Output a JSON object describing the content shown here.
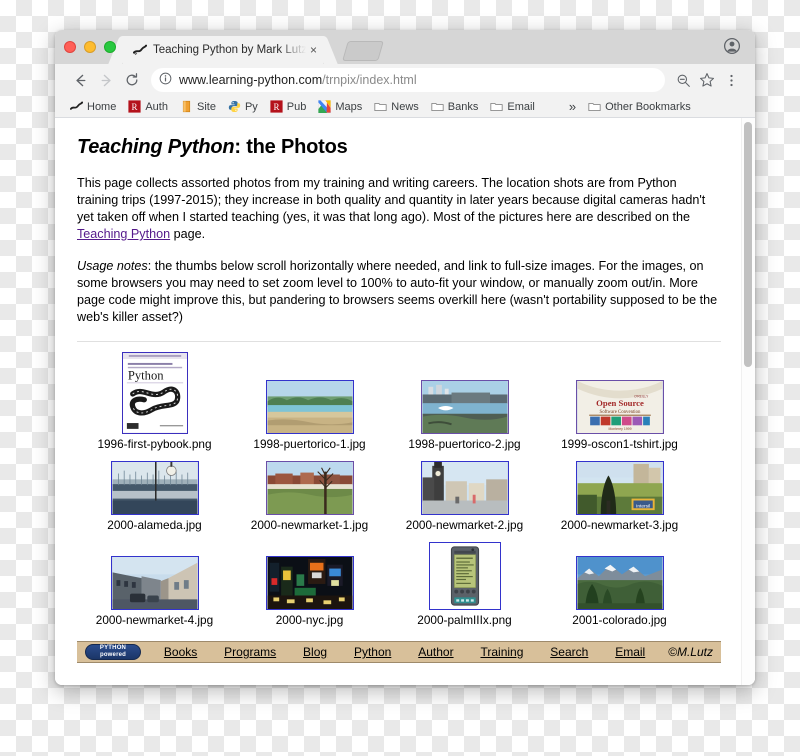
{
  "window": {
    "traffic_lights": [
      "close",
      "minimize",
      "maximize"
    ],
    "tab": {
      "title": "Teaching Python by Mark Lutz",
      "close_label": "×",
      "favicon": "python-snake-icon"
    },
    "new_tab_label": "+"
  },
  "toolbar": {
    "back_label": "←",
    "forward_label": "→",
    "reload_label": "↻",
    "url_host": "www.learning-python.com",
    "url_path": "/trnpix/index.html",
    "zoom_out_icon": "zoom-out-icon",
    "star_icon": "star-icon",
    "menu_icon": "three-dot-menu-icon",
    "profile_icon": "profile-avatar-icon"
  },
  "bookmarks": {
    "items": [
      {
        "label": "Home",
        "icon": "python-snake-icon"
      },
      {
        "label": "Auth",
        "icon": "oreilly-red-icon"
      },
      {
        "label": "Site",
        "icon": "orange-book-icon"
      },
      {
        "label": "Py",
        "icon": "python-logo-icon"
      },
      {
        "label": "Pub",
        "icon": "oreilly-red-icon"
      },
      {
        "label": "Maps",
        "icon": "google-maps-icon"
      },
      {
        "label": "News",
        "icon": "folder-icon"
      },
      {
        "label": "Banks",
        "icon": "folder-icon"
      },
      {
        "label": "Email",
        "icon": "folder-icon"
      }
    ],
    "overflow_label": "»",
    "other_label": "Other Bookmarks",
    "other_icon": "folder-icon"
  },
  "page": {
    "title_em": "Teaching Python",
    "title_rest": ": the Photos",
    "paragraph1_a": "This page collects assorted photos from my training and writing careers. The location shots are from Python training trips (1997-2015); they increase in both quality and quantity in later years because digital cameras hadn't yet taken off when I started teaching (yes, it was that long ago). Most of the pictures here are described on the ",
    "paragraph1_link": "Teaching Python",
    "paragraph1_b": " page.",
    "paragraph2_em": "Usage notes",
    "paragraph2_rest": ": the thumbs below scroll horizontally where needed, and link to full-size images. For the images, on some browsers you may need to set zoom level to 100% to auto-fit your window, or manually zoom out/in. More page code might improve this, but pandering to browsers seems overkill here (wasn't portability supposed to be the web's killer asset?)",
    "thumbnails": [
      [
        {
          "caption": "1996-first-pybook.png",
          "shape": "tall",
          "alt": "Programming Python book cover with snake"
        },
        {
          "caption": "1998-puertorico-1.jpg",
          "shape": "wide",
          "alt": "Beach with palm trees"
        },
        {
          "caption": "1998-puertorico-2.jpg",
          "shape": "wide",
          "alt": "Coastal fort and sea"
        },
        {
          "caption": "1999-oscon1-tshirt.jpg",
          "shape": "wide",
          "alt": "Open Source Software Convention t-shirt"
        }
      ],
      [
        {
          "caption": "2000-alameda.jpg",
          "shape": "wide",
          "alt": "Marina with sailboats"
        },
        {
          "caption": "2000-newmarket-1.jpg",
          "shape": "wide",
          "alt": "Field with bare tree and houses"
        },
        {
          "caption": "2000-newmarket-2.jpg",
          "shape": "wide",
          "alt": "Town clock tower street"
        },
        {
          "caption": "2000-newmarket-3.jpg",
          "shape": "wide",
          "alt": "Road with dark tree and grass"
        }
      ],
      [
        {
          "caption": "2000-newmarket-4.jpg",
          "shape": "wide",
          "alt": "Terraced street with cars"
        },
        {
          "caption": "2000-nyc.jpg",
          "shape": "wide",
          "alt": "Times Square at night"
        },
        {
          "caption": "2000-palmIIIx.png",
          "shape": "palm",
          "alt": "Palm IIIx handheld device"
        },
        {
          "caption": "2001-colorado.jpg",
          "shape": "wide",
          "alt": "Snowy mountains with pines"
        }
      ]
    ]
  },
  "footer": {
    "badge_line1": "PYTHON",
    "badge_line2": "powered",
    "links": [
      "Books",
      "Programs",
      "Blog",
      "Python",
      "Author",
      "Training",
      "Search",
      "Email"
    ],
    "copyright": "©M.Lutz"
  },
  "colors": {
    "thumb_border": "#3333cc",
    "visited_link": "#551a8b",
    "footer_bg": "#d8c09a",
    "accent_red": "#ff5f57",
    "accent_yellow": "#febc2e",
    "accent_green": "#28c840"
  }
}
